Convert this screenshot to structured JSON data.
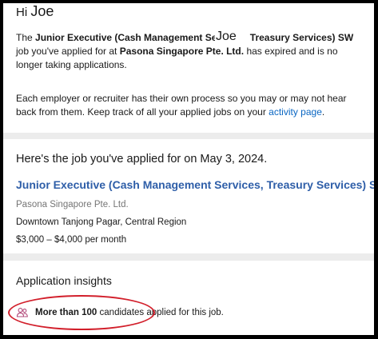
{
  "greeting": {
    "hi": "Hi",
    "name": "Joe"
  },
  "notice": {
    "title_part1": "Junior Executive (Cash Management Serv",
    "title_part2": "Treasury Services) SW",
    "name_overlay": "Joe",
    "job_label": "job",
    "applied_text": "you've applied for at",
    "company": "Pasona Singapore Pte. Ltd.",
    "expired_text": "has expired and is no longer taking applications.",
    "process_text": "Each employer or recruiter has their own process so you may or may not hear back from them. Keep track of all your applied jobs on your",
    "activity_link": "activity page",
    "period": "."
  },
  "job": {
    "heading": "Here's the job you've applied for on May 3, 2024.",
    "title": "Junior Executive (Cash Management Services, Treasury Services) SW",
    "company": "Pasona Singapore Pte. Ltd.",
    "location": "Downtown Tanjong Pagar, Central Region",
    "salary": "$3,000 – $4,000 per month"
  },
  "insights": {
    "title": "Application insights",
    "count_bold": "More than 100",
    "count_rest": "candidates applied for this job.",
    "icon": "people-icon",
    "highlight_color": "#d21f2b"
  },
  "colors": {
    "link": "#0a66c2",
    "job_title": "#2e5ea8",
    "muted": "#757575"
  }
}
